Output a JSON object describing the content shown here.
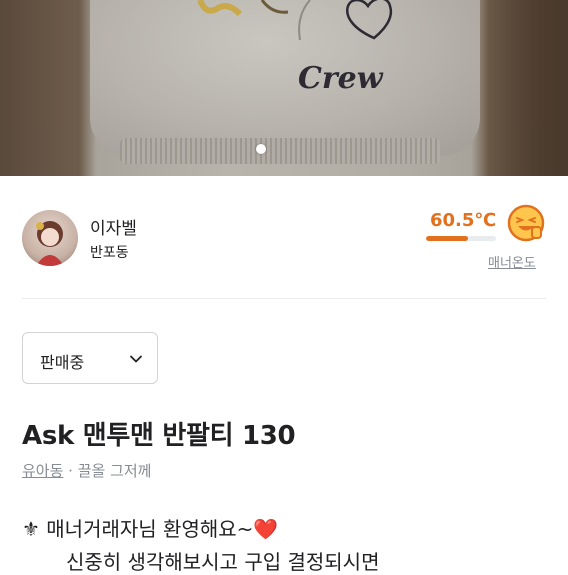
{
  "photo": {
    "print_text": "Crew",
    "pager_active": 1
  },
  "seller": {
    "name": "이자벨",
    "location": "반포동",
    "manner_temperature": "60.5℃",
    "temperature_level": 0.6,
    "manner_label": "매너온도",
    "temp_color": "#e2711d",
    "face_icon": "smiling-face-icon"
  },
  "status": {
    "selected": "판매중"
  },
  "listing": {
    "title": "Ask 맨투맨 반팔티 130",
    "category": "유아동",
    "separator": " · ",
    "bumped": "끌올 그저께"
  },
  "description": {
    "line1": "⚜ 매너거래자님 환영해요~❤️",
    "line2": "신중히 생각해보시고 구입 결정되시면"
  }
}
